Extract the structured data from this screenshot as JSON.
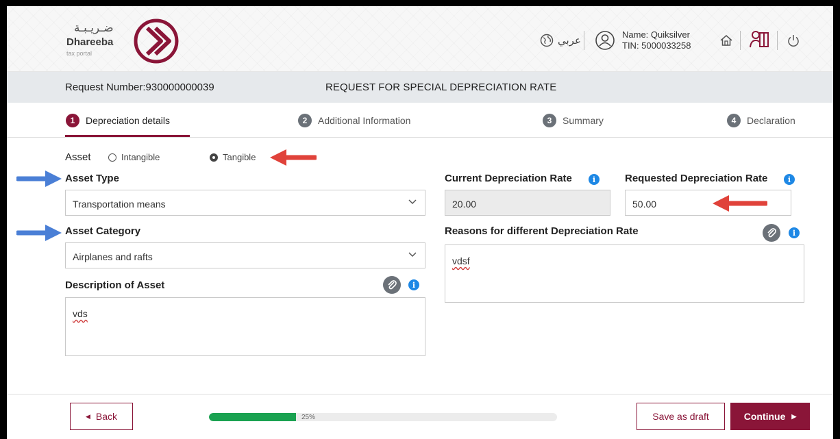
{
  "header": {
    "logo_arabic": "ضـريـبـة",
    "logo_name": "Dhareeba",
    "logo_sub": "tax portal",
    "language_toggle": "عربي",
    "user_name": "Name: Quiksilver",
    "user_tin": "TIN: 5000033258"
  },
  "request": {
    "number": "Request Number:930000000039",
    "title": "REQUEST FOR SPECIAL DEPRECIATION RATE"
  },
  "steps": [
    {
      "num": "1",
      "label": "Depreciation details",
      "active": true
    },
    {
      "num": "2",
      "label": "Additional Information"
    },
    {
      "num": "3",
      "label": "Summary"
    },
    {
      "num": "4",
      "label": "Declaration"
    }
  ],
  "form": {
    "asset_label": "Asset",
    "asset_options": [
      "Intangible",
      "Tangible"
    ],
    "asset_selected": "Tangible",
    "asset_type_label": "Asset Type",
    "asset_type_value": "Transportation means",
    "asset_category_label": "Asset Category",
    "asset_category_value": "Airplanes and rafts",
    "description_label": "Description of Asset",
    "description_value": "vds",
    "current_rate_label": "Current Depreciation Rate",
    "current_rate_value": "20.00",
    "requested_rate_label": "Requested Depreciation Rate",
    "requested_rate_value": "50.00",
    "reasons_label": "Reasons for different Depreciation Rate",
    "reasons_value": "vdsf"
  },
  "footer": {
    "back_label": "Back",
    "save_draft_label": "Save as draft",
    "continue_label": "Continue",
    "progress_text": "25%",
    "progress_fraction": 0.25
  },
  "colors": {
    "brand": "#8a1538",
    "info": "#1e88e5",
    "progress": "#1aa251",
    "annotation_red": "#e0423a",
    "annotation_blue": "#4a7fd6"
  }
}
